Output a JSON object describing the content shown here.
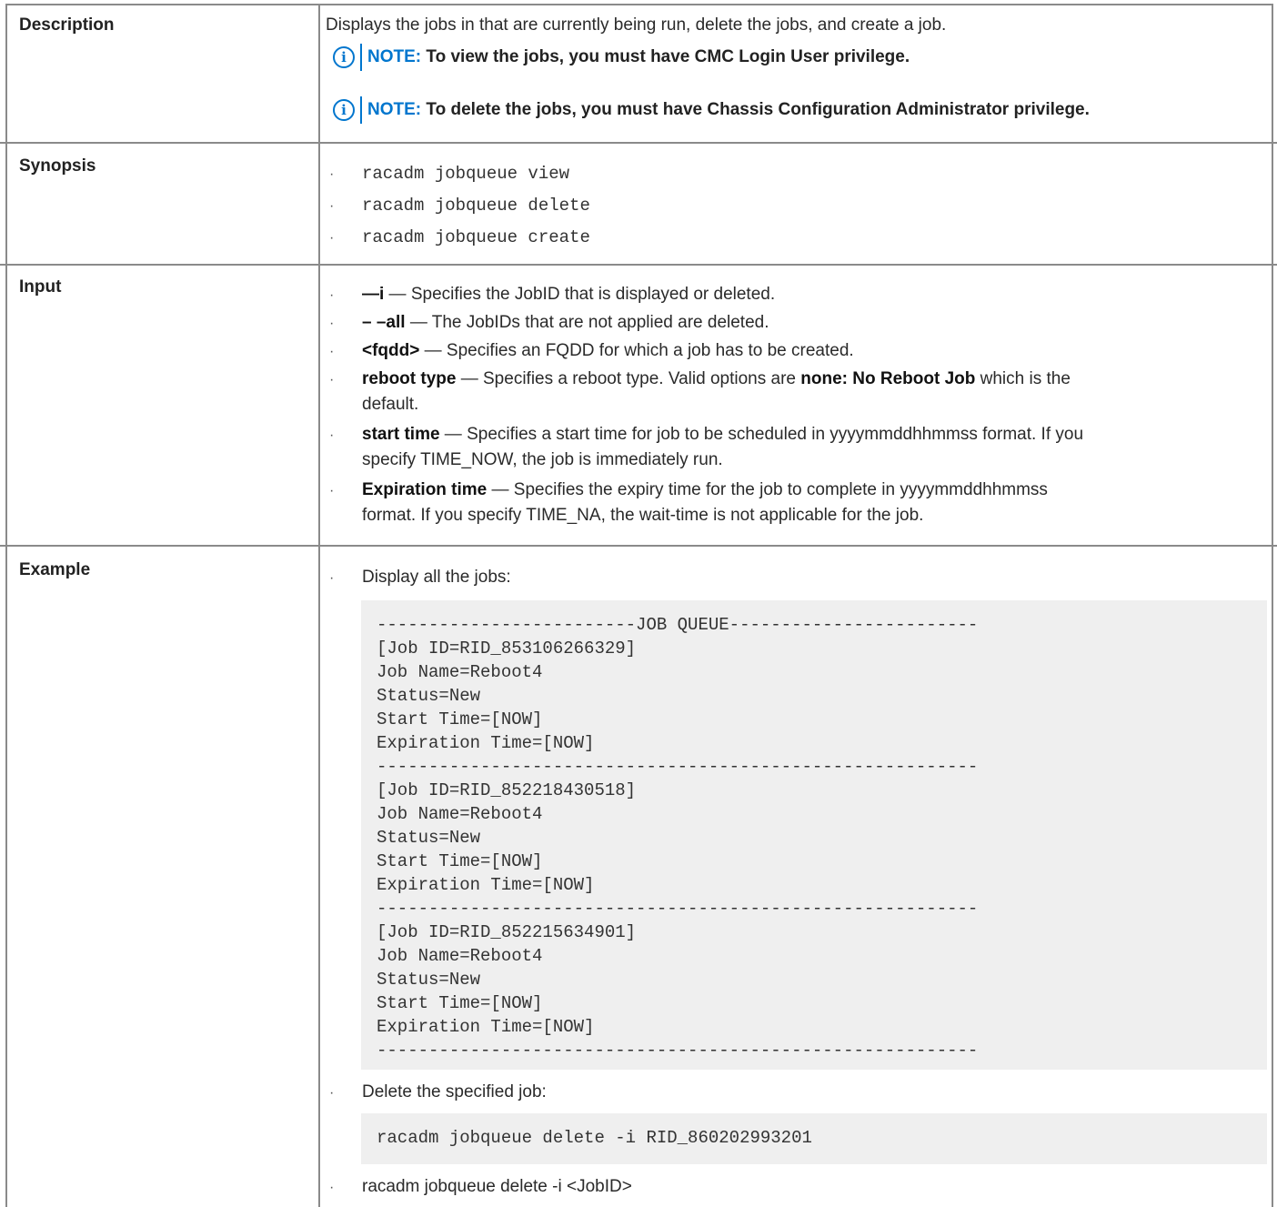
{
  "description": {
    "label": "Description",
    "text": "Displays the jobs in that are currently being run, delete the jobs, and create a job.",
    "notes": [
      {
        "kw": "NOTE:",
        "text": " To view the jobs, you must have CMC Login User privilege."
      },
      {
        "kw": "NOTE:",
        "text": " To delete the jobs, you must have Chassis Configuration Administrator privilege."
      }
    ],
    "note_icon": "i"
  },
  "synopsis": {
    "label": "Synopsis",
    "items": [
      "racadm jobqueue view",
      "racadm jobqueue delete",
      "racadm jobqueue create"
    ]
  },
  "input": {
    "label": "Input",
    "items": [
      {
        "term": "—i",
        "text": " — Specifies the JobID that is displayed or deleted."
      },
      {
        "term": "– –all",
        "text": " — The JobIDs that are not applied are deleted."
      },
      {
        "term": "<fqdd>",
        "text": " — Specifies an FQDD for which a job has to be created."
      },
      {
        "term": "reboot type",
        "text": " — Specifies a reboot type. Valid options are ",
        "term2": "none: No Reboot Job",
        "text2": " which is the",
        "cont": "default."
      },
      {
        "term": "start time",
        "text": " — Specifies a start time for job to be scheduled in yyyymmddhhmmss format. If you",
        "cont": "specify TIME_NOW, the job is immediately run."
      },
      {
        "term": "Expiration time",
        "text": " — Specifies the expiry time for the job to complete in yyyymmddhhmmss",
        "cont": "format. If you specify TIME_NA, the wait-time is not applicable for the job."
      }
    ]
  },
  "example": {
    "label": "Example",
    "item1": "Display all the jobs:",
    "code1": [
      "-------------------------JOB QUEUE------------------------",
      "[Job ID=RID_853106266329]",
      "Job Name=Reboot4",
      "Status=New",
      "Start Time=[NOW]",
      "Expiration Time=[NOW]",
      "----------------------------------------------------------",
      "[Job ID=RID_852218430518]",
      "Job Name=Reboot4",
      "Status=New",
      "Start Time=[NOW]",
      "Expiration Time=[NOW]",
      "----------------------------------------------------------",
      "[Job ID=RID_852215634901]",
      "Job Name=Reboot4",
      "Status=New",
      "Start Time=[NOW]",
      "Expiration Time=[NOW]",
      "----------------------------------------------------------"
    ],
    "item2": "Delete the specified job:",
    "code2": "racadm jobqueue delete -i RID_860202993201",
    "item3": "racadm jobqueue delete -i <JobID>"
  },
  "bullet_char": "·"
}
